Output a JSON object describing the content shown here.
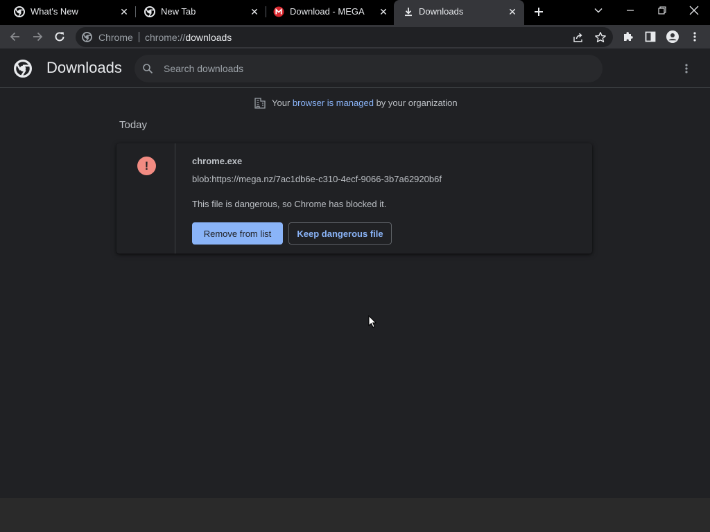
{
  "tabs": [
    {
      "title": "What's New",
      "icon": "chrome-icon"
    },
    {
      "title": "New Tab",
      "icon": "chrome-icon"
    },
    {
      "title": "Download - MEGA",
      "icon": "mega-icon"
    },
    {
      "title": "Downloads",
      "icon": "download-icon",
      "active": true
    }
  ],
  "toolbar": {
    "chip_label": "Chrome",
    "url_prefix": "chrome://",
    "url_path": "downloads"
  },
  "downloads": {
    "page_title": "Downloads",
    "search_placeholder": "Search downloads"
  },
  "managed_notice": {
    "prefix": "Your ",
    "link": "browser is managed",
    "suffix": " by your organization"
  },
  "date_group": "Today",
  "item": {
    "file_name": "chrome.exe",
    "url": "blob:https://mega.nz/7ac1db6e-c310-4ecf-9066-3b7a62920b6f",
    "status": "This file is dangerous, so Chrome has blocked it.",
    "remove_label": "Remove from list",
    "keep_label": "Keep dangerous file"
  },
  "colors": {
    "accent": "#8ab4f8",
    "danger": "#f28b82",
    "background": "#202124"
  }
}
